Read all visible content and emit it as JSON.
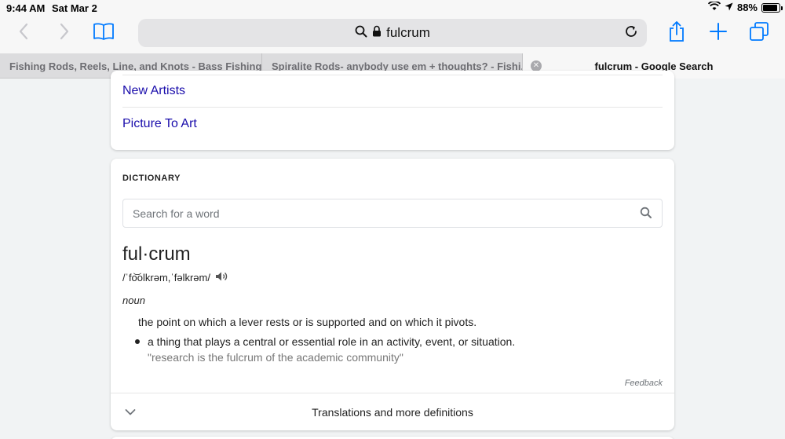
{
  "status_bar": {
    "time": "9:44 AM",
    "date": "Sat Mar 2",
    "battery_percent": "88%",
    "battery_level": 0.88
  },
  "toolbar": {
    "address_text": "fulcrum",
    "icons": [
      "back-icon",
      "forward-icon",
      "bookmarks-icon",
      "search-icon",
      "lock-icon",
      "reload-icon",
      "share-icon",
      "new-tab-icon",
      "tabs-icon"
    ]
  },
  "tabs": [
    {
      "label": "Fishing Rods, Reels, Line, and Knots - Bass Fishing..."
    },
    {
      "label": "Spiralite Rods- anybody use em + thoughts? - Fishi..."
    },
    {
      "label": "fulcrum - Google Search",
      "active": true
    }
  ],
  "related": {
    "items": [
      "New Artists",
      "Picture To Art"
    ]
  },
  "dictionary": {
    "heading": "DICTIONARY",
    "search_placeholder": "Search for a word",
    "word": "ful·crum",
    "phonetic": "/ˈfo͝olkrəm,ˈfəlkrəm/",
    "part_of_speech": "noun",
    "definition_1": "the point on which a lever rests or is supported and on which it pivots.",
    "definition_2": "a thing that plays a central or essential role in an activity, event, or situation.",
    "example_2": "\"research is the fulcrum of the academic community\"",
    "feedback": "Feedback",
    "more_label": "Translations and more definitions"
  },
  "colors": {
    "link": "#1a0dab",
    "accent": "#007aff"
  }
}
